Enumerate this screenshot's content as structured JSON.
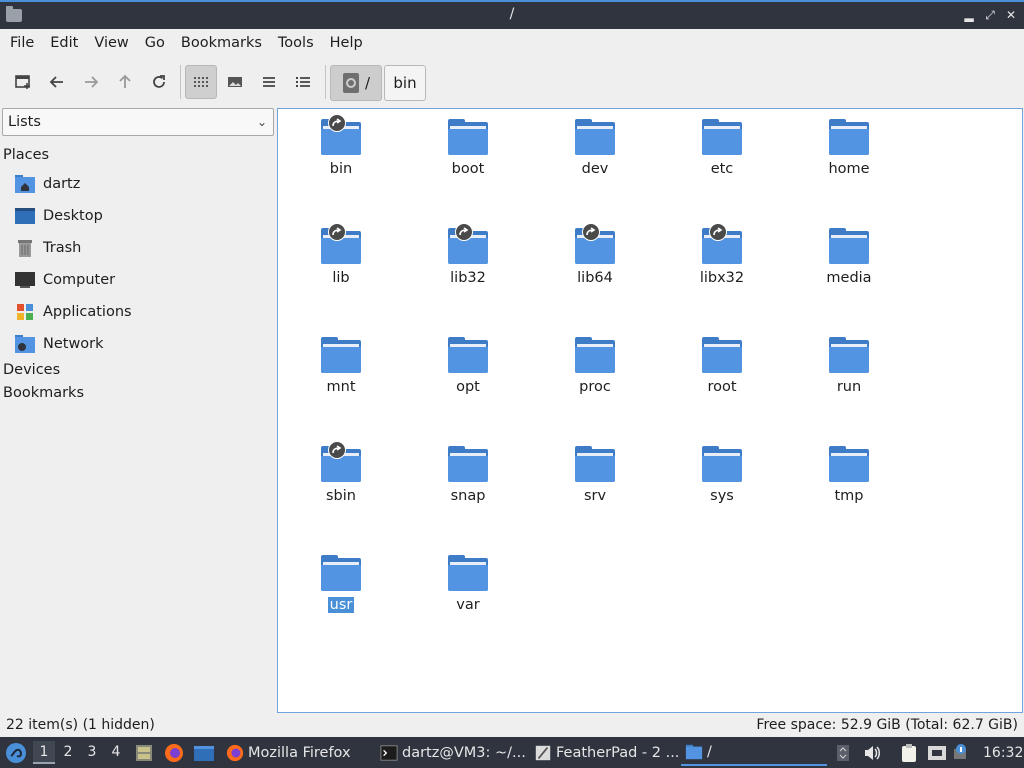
{
  "window": {
    "title": "/"
  },
  "menubar": [
    "File",
    "Edit",
    "View",
    "Go",
    "Bookmarks",
    "Tools",
    "Help"
  ],
  "path": {
    "root_label": "/",
    "next_label": "bin"
  },
  "sidebar": {
    "combo_value": "Lists",
    "places_header": "Places",
    "places": [
      "dartz",
      "Desktop",
      "Trash",
      "Computer",
      "Applications",
      "Network"
    ],
    "devices_header": "Devices",
    "bookmarks_header": "Bookmarks"
  },
  "files": {
    "items": [
      {
        "name": "bin",
        "symlink": true
      },
      {
        "name": "boot",
        "symlink": false
      },
      {
        "name": "dev",
        "symlink": false
      },
      {
        "name": "etc",
        "symlink": false
      },
      {
        "name": "home",
        "symlink": false
      },
      {
        "name": "lib",
        "symlink": true
      },
      {
        "name": "lib32",
        "symlink": true
      },
      {
        "name": "lib64",
        "symlink": true
      },
      {
        "name": "libx32",
        "symlink": true
      },
      {
        "name": "media",
        "symlink": false
      },
      {
        "name": "mnt",
        "symlink": false
      },
      {
        "name": "opt",
        "symlink": false
      },
      {
        "name": "proc",
        "symlink": false
      },
      {
        "name": "root",
        "symlink": false
      },
      {
        "name": "run",
        "symlink": false
      },
      {
        "name": "sbin",
        "symlink": true
      },
      {
        "name": "snap",
        "symlink": false
      },
      {
        "name": "srv",
        "symlink": false
      },
      {
        "name": "sys",
        "symlink": false
      },
      {
        "name": "tmp",
        "symlink": false
      },
      {
        "name": "usr",
        "symlink": false,
        "selected": true
      },
      {
        "name": "var",
        "symlink": false
      }
    ]
  },
  "status": {
    "items": "22 item(s) (1 hidden)",
    "free_space": "Free space: 52.9 GiB (Total: 62.7 GiB)"
  },
  "taskbar": {
    "desktops": [
      "1",
      "2",
      "3",
      "4"
    ],
    "tasks": [
      "Mozilla Firefox",
      "dartz@VM3: ~/...",
      "FeatherPad - 2 ...",
      "/"
    ],
    "clock": "16:32"
  },
  "colors": {
    "accent": "#4a90d9",
    "folder": "#5294e2",
    "panel": "#2f343f"
  }
}
